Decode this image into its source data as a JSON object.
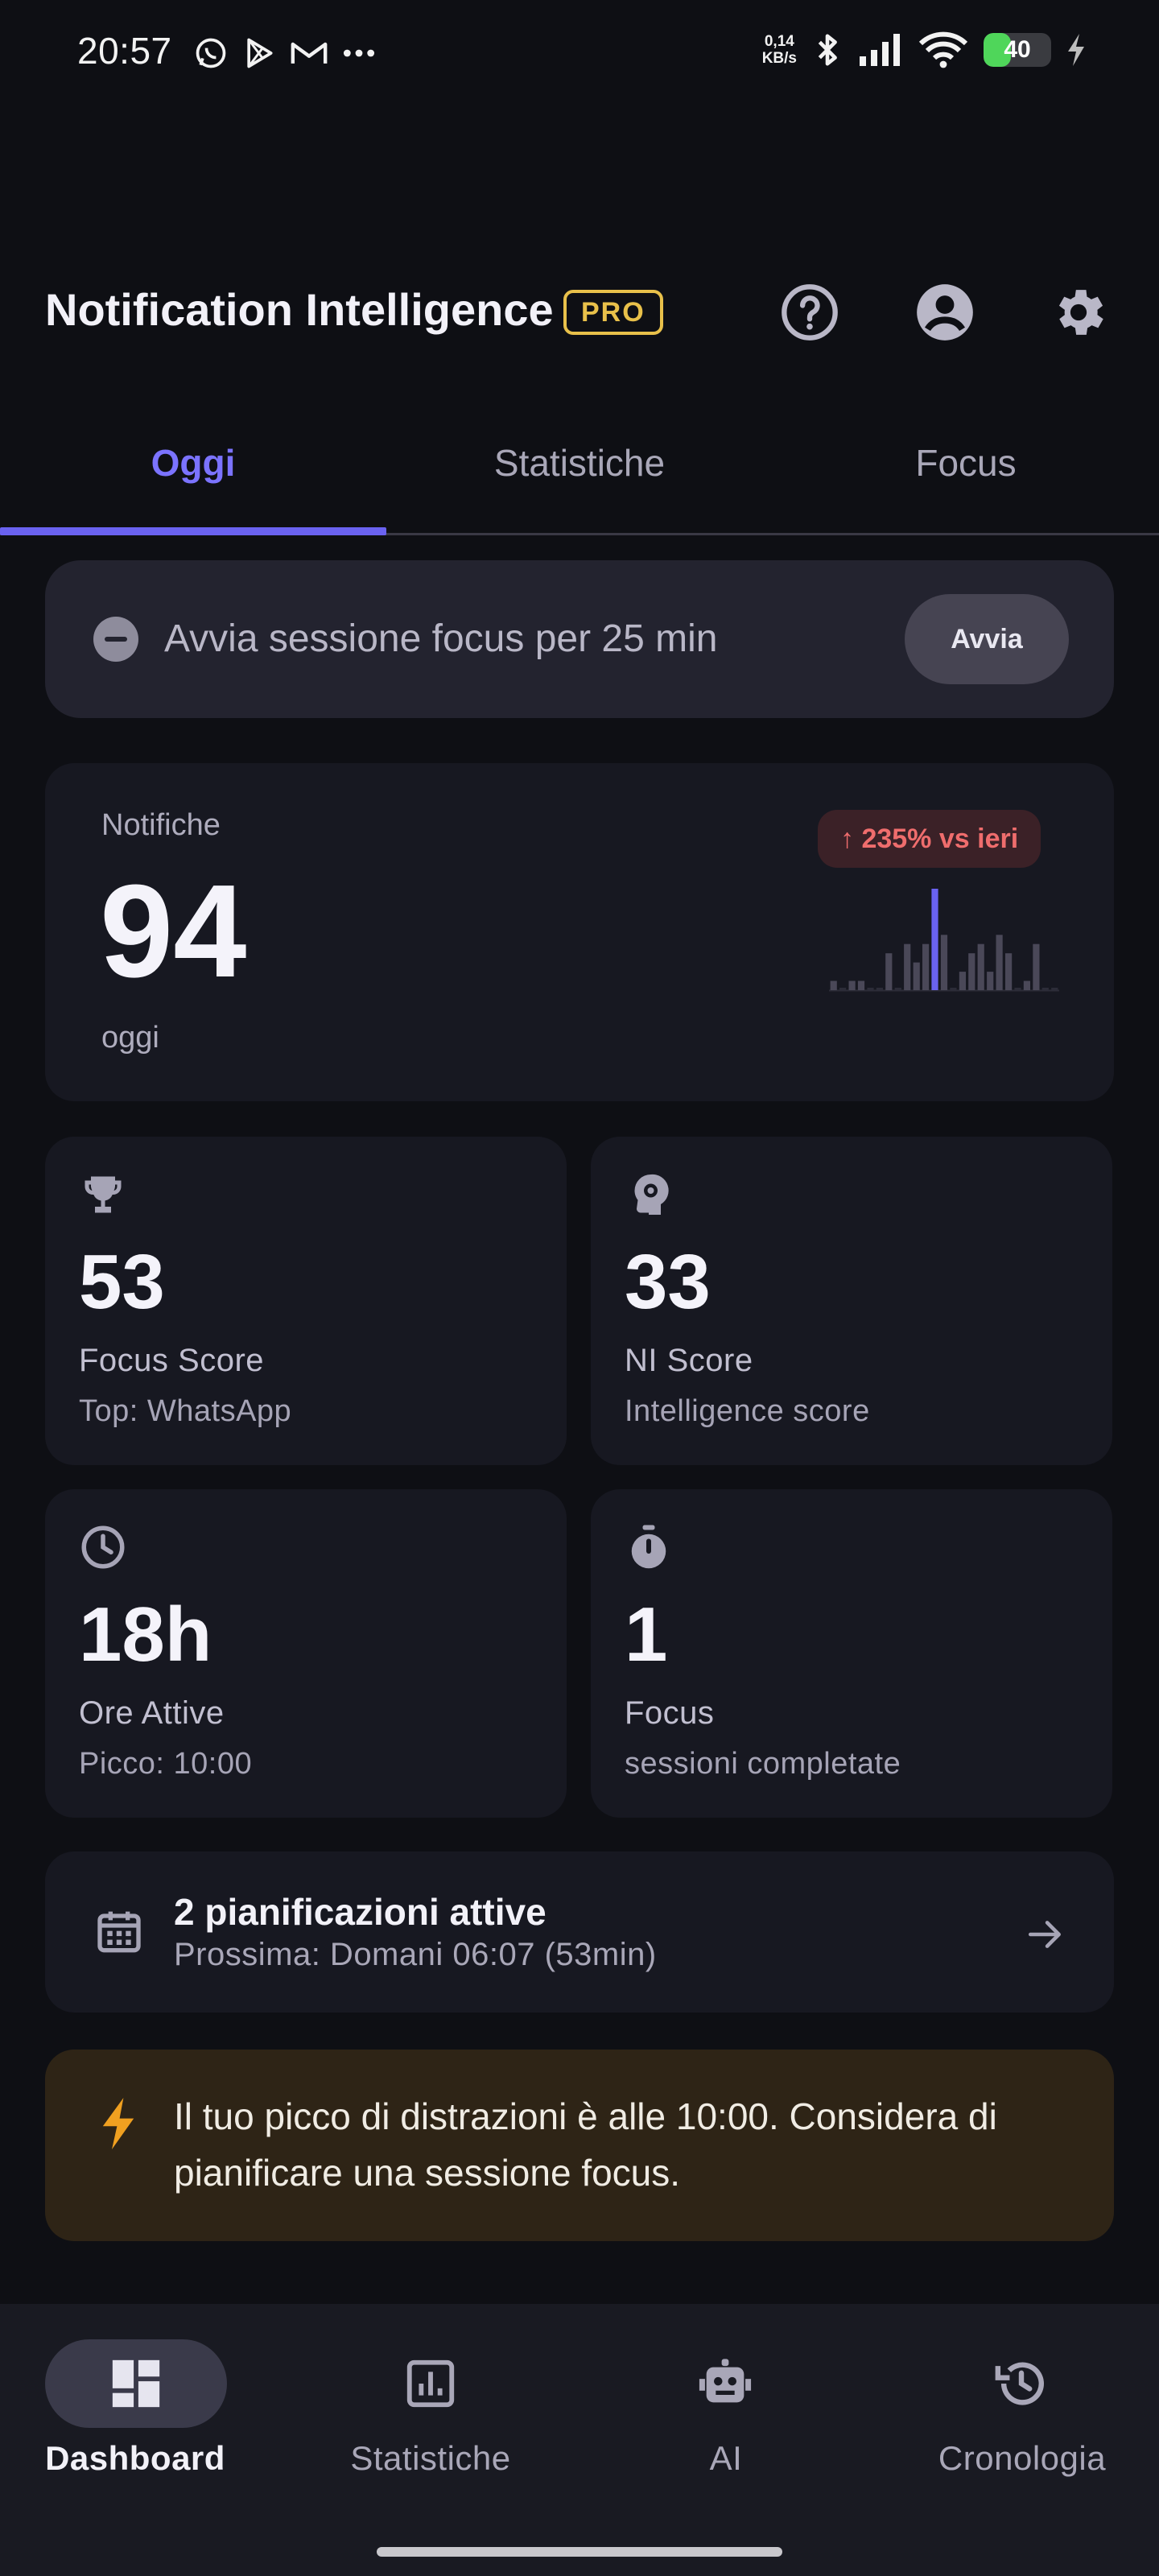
{
  "status_bar": {
    "time": "20:57",
    "speed_value": "0,14",
    "speed_unit": "KB/s",
    "battery": "40",
    "battery_level": 0.4
  },
  "header": {
    "title": "Notification Intelligence",
    "badge": "PRO",
    "icons": [
      "help-icon",
      "account-icon",
      "settings-icon"
    ]
  },
  "tabs": [
    {
      "label": "Oggi",
      "active": true
    },
    {
      "label": "Statistiche",
      "active": false
    },
    {
      "label": "Focus",
      "active": false
    }
  ],
  "focus_bar": {
    "text": "Avvia sessione focus per 25 min",
    "button": "Avvia"
  },
  "notifications": {
    "label": "Notifiche",
    "count": "94",
    "sub": "oggi",
    "trend": "↑ 235% vs ieri",
    "hourly": [
      1,
      0,
      1,
      1,
      0,
      0,
      4,
      0,
      5,
      3,
      5,
      11,
      6,
      0,
      2,
      4,
      5,
      2,
      6,
      4,
      0,
      1,
      5,
      0,
      0
    ],
    "highlight_index": 11
  },
  "stats": [
    {
      "icon": "trophy-icon",
      "value": "53",
      "label": "Focus Score",
      "sub": "Top: WhatsApp"
    },
    {
      "icon": "brain-gear-icon",
      "value": "33",
      "label": "NI Score",
      "sub": "Intelligence score"
    },
    {
      "icon": "clock-icon",
      "value": "18h",
      "label": "Ore Attive",
      "sub": "Picco: 10:00"
    },
    {
      "icon": "timer-icon",
      "value": "1",
      "label": "Focus",
      "sub": "sessioni completate"
    }
  ],
  "schedule": {
    "title": "2 pianificazioni attive",
    "sub": "Prossima: Domani 06:07 (53min)"
  },
  "tip": {
    "text": "Il tuo picco di distrazioni è alle 10:00. Considera di pianificare una sessione focus."
  },
  "bottom_nav": [
    {
      "label": "Dashboard",
      "icon": "dashboard-icon",
      "active": true
    },
    {
      "label": "Statistiche",
      "icon": "stats-icon",
      "active": false
    },
    {
      "label": "AI",
      "icon": "robot-icon",
      "active": false
    },
    {
      "label": "Cronologia",
      "icon": "history-icon",
      "active": false
    }
  ],
  "colors": {
    "accent": "#6a62f0",
    "pro_gold": "#e8c04a",
    "trend_red": "#ef6d6d",
    "tip_bg": "#2e2416",
    "tip_icon": "#f0a020"
  }
}
